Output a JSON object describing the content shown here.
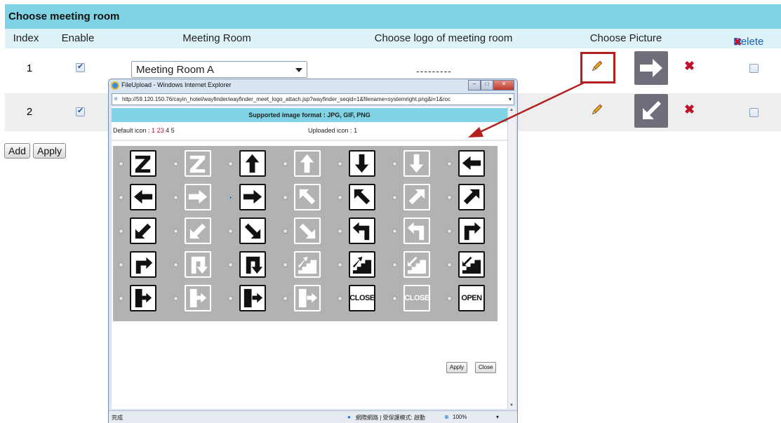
{
  "page": {
    "title": "Choose meeting room",
    "columns": {
      "index": "Index",
      "enable": "Enable",
      "meeting_room": "Meeting Room",
      "logo": "Choose logo of meeting room",
      "picture": "Choose Picture",
      "delete": "Delete"
    },
    "rows": [
      {
        "index": "1",
        "enabled": true,
        "room": "Meeting Room A",
        "logo": "---------"
      },
      {
        "index": "2",
        "enabled": true
      }
    ],
    "buttons": {
      "add": "Add",
      "apply": "Apply"
    }
  },
  "popup": {
    "title": "FileUpload - Windows Internet Explorer",
    "url": "http://59.120.150.76/cayin_hotel/wayfinder/wayfinder_meet_logo_attach.jsp?wayfinder_seqid=1&filename=systemright.png&i=1&roc",
    "formats": "Supported image format : JPG, GIF, PNG",
    "default_icon_label": "Default icon :",
    "default_pages": [
      "1",
      "2",
      "3",
      "4",
      "5"
    ],
    "uploaded_icon_label": "Uploaded icon :",
    "uploaded_pages": [
      "1"
    ],
    "icons": [
      "Z-icon",
      "Z-icon",
      "arrow-up-icon",
      "arrow-up-icon",
      "arrow-down-icon",
      "arrow-down-icon",
      "arrow-left-icon",
      "arrow-left-icon",
      "arrow-right-icon",
      "arrow-right-icon",
      "arrow-up-left-icon",
      "arrow-up-left-icon",
      "arrow-up-right-icon",
      "arrow-up-right-icon",
      "arrow-down-left-icon",
      "arrow-down-left-icon",
      "arrow-down-right-icon",
      "arrow-down-right-icon",
      "turn-left-icon",
      "turn-left-icon",
      "turn-right-icon",
      "turn-right-up-icon",
      "u-turn-down-icon",
      "u-turn-down-icon",
      "stairs-up-icon",
      "stairs-up-icon",
      "stairs-down-icon",
      "stairs-down-icon",
      "exit-door-in-icon",
      "exit-door-in-icon",
      "exit-door-out-icon",
      "exit-door-out-icon",
      "close-sign-icon",
      "close-sign-icon",
      "open-sign-icon"
    ],
    "icon_texts": {
      "32": "CLOSE",
      "33": "CLOSE",
      "34": "OPEN"
    },
    "selected_icon": 9,
    "buttons": {
      "apply": "Apply",
      "close": "Close"
    },
    "status": {
      "left": "完成",
      "zone": "網際網路 | 受保護模式: 啟動",
      "zoom": "100%"
    }
  },
  "colors": {
    "header": "#7fd3e4",
    "subheader": "#ddf3f8",
    "grid_bg": "#b2b2b2",
    "delete": "#c0102a",
    "annotation": "#b41f1f"
  }
}
